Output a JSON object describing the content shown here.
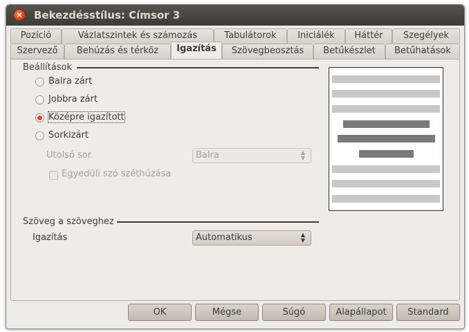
{
  "window": {
    "title": "Bekezdésstílus: Címsor 3"
  },
  "tabs_row1": [
    "Pozíció",
    "Vázlatszintek és számozás",
    "Tabulátorok",
    "Iniciálék",
    "Háttér",
    "Szegélyek"
  ],
  "tabs_row2": [
    "Szervező",
    "Behúzás és térköz",
    "Igazítás",
    "Szövegbeosztás",
    "Betűkészlet",
    "Betűhatások"
  ],
  "options": {
    "title": "Beállítások",
    "radio": [
      {
        "label": "Balra zárt",
        "checked": false
      },
      {
        "label": "Jobbra zárt",
        "checked": false
      },
      {
        "label": "Középre igazított",
        "checked": true
      },
      {
        "label": "Sorkizárt",
        "checked": false
      }
    ],
    "last_line_label": "Utolsó sor",
    "last_line_value": "Balra",
    "expand_word_label": "Egyedüli szó széthúzása"
  },
  "text_to_text": {
    "title": "Szöveg a szöveghez",
    "align_label": "Igazítás",
    "align_value": "Automatikus"
  },
  "buttons": {
    "ok": "OK",
    "cancel": "Mégse",
    "help": "Súgó",
    "reset": "Alapállapot",
    "standard": "Standard"
  },
  "colors": {
    "accent": "#d64b22",
    "titlebar": "#3d3b37",
    "dialog_bg": "#efebe7"
  }
}
